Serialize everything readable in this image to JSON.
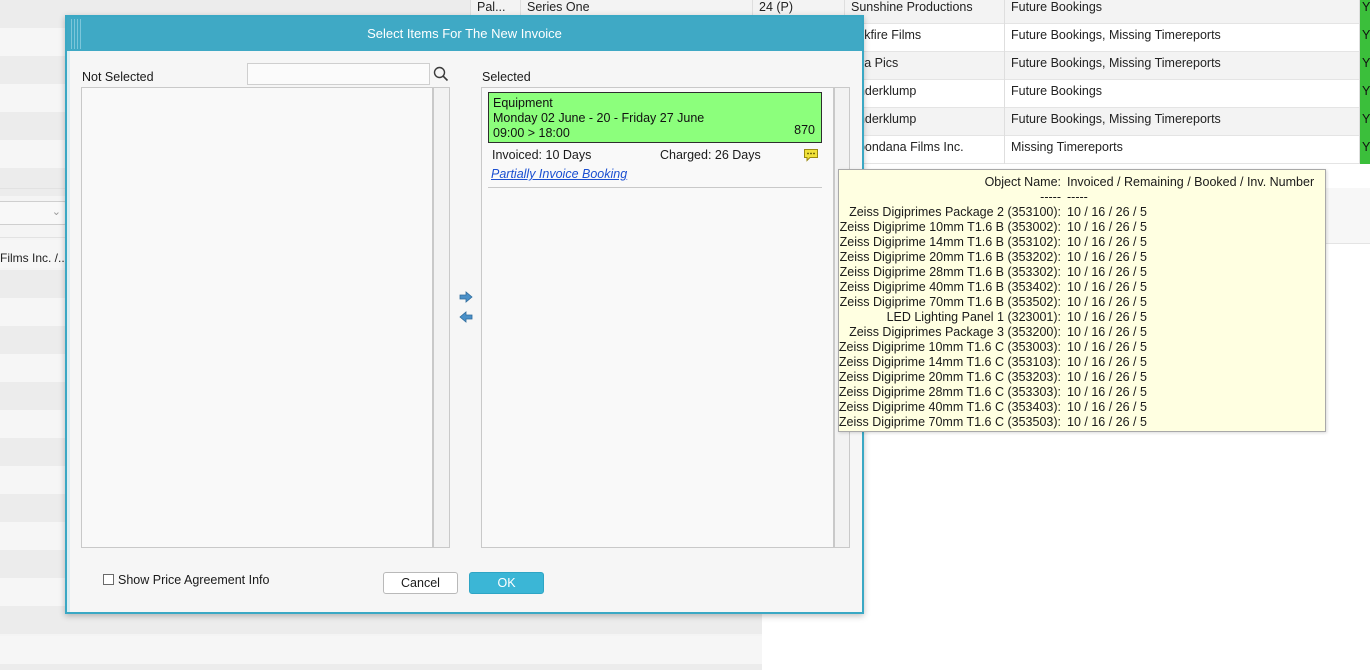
{
  "background": {
    "left_panel": {
      "clipped_text": "Films Inc. /.."
    },
    "table_rows": [
      {
        "col1": "Pal...",
        "col2": "Series One",
        "col3": "24 (P)",
        "company": "Sunshine Productions",
        "status": "Future Bookings",
        "flag": "Y"
      },
      {
        "col1": "",
        "col2": "",
        "col3": "",
        "company": "ackfire Films",
        "status": "Future Bookings, Missing Timereports",
        "flag": "Y"
      },
      {
        "col1": "",
        "col2": "",
        "col3": "",
        "company": "aya Pics",
        "status": "Future Bookings, Missing Timereports",
        "flag": "Y"
      },
      {
        "col1": "",
        "col2": "",
        "col3": "",
        "company": "underklump",
        "status": "Future Bookings",
        "flag": "Y"
      },
      {
        "col1": "",
        "col2": "",
        "col3": "",
        "company": "underklump",
        "status": "Future Bookings, Missing Timereports",
        "flag": "Y"
      },
      {
        "col1": "",
        "col2": "",
        "col3": "",
        "company": "apondana Films Inc.",
        "status": "Missing Timereports",
        "flag": "Y"
      }
    ],
    "colors": {
      "flag_green": "#3bbf3b"
    }
  },
  "dialog": {
    "title": "Select Items For The New Invoice",
    "not_selected_label": "Not Selected",
    "search": {
      "value": "",
      "placeholder": "",
      "icon": "search-icon"
    },
    "selected_label": "Selected",
    "booking": {
      "title": "Equipment",
      "dates": "Monday 02 June - 20 - Friday 27 June",
      "time": "09:00 > 18:00",
      "number": "870",
      "invoiced": "Invoiced: 10 Days",
      "charged": "Charged: 26 Days",
      "comment_icon": "comment-icon",
      "partial_link": "Partially Invoice Booking"
    },
    "move_right_icon": "arrow-right-icon",
    "move_left_icon": "arrow-left-icon",
    "show_price_agreement_label": "Show Price Agreement Info",
    "show_price_agreement_checked": false,
    "cancel_label": "Cancel",
    "ok_label": "OK",
    "colors": {
      "titlebar": "#3fa9c5",
      "booking_card": "#8cff7c",
      "ok_button": "#3bb6d6",
      "link": "#1b4fd1"
    }
  },
  "tooltip": {
    "header_name": "Object Name:",
    "header_value": "Invoiced / Remaining / Booked / Inv. Number",
    "separator_name": "-----",
    "separator_value": "-----",
    "items": [
      {
        "name": "Zeiss Digiprimes Package 2 (353100):",
        "value": "10 / 16 / 26 / 5"
      },
      {
        "name": "Zeiss Digiprime 10mm T1.6 B (353002):",
        "value": "10 / 16 / 26 / 5"
      },
      {
        "name": "Zeiss Digiprime 14mm T1.6 B (353102):",
        "value": "10 / 16 / 26 / 5"
      },
      {
        "name": "Zeiss Digiprime 20mm T1.6 B (353202):",
        "value": "10 / 16 / 26 / 5"
      },
      {
        "name": "Zeiss Digiprime 28mm T1.6 B (353302):",
        "value": "10 / 16 / 26 / 5"
      },
      {
        "name": "Zeiss Digiprime 40mm T1.6 B (353402):",
        "value": "10 / 16 / 26 / 5"
      },
      {
        "name": "Zeiss Digiprime 70mm T1.6 B (353502):",
        "value": "10 / 16 / 26 / 5"
      },
      {
        "name": "LED Lighting Panel 1 (323001):",
        "value": "10 / 16 / 26 / 5"
      },
      {
        "name": "Zeiss Digiprimes Package 3 (353200):",
        "value": "10 / 16 / 26 / 5"
      },
      {
        "name": "Zeiss Digiprime 10mm T1.6 C (353003):",
        "value": "10 / 16 / 26 / 5"
      },
      {
        "name": "Zeiss Digiprime 14mm T1.6 C (353103):",
        "value": "10 / 16 / 26 / 5"
      },
      {
        "name": "Zeiss Digiprime 20mm T1.6 C (353203):",
        "value": "10 / 16 / 26 / 5"
      },
      {
        "name": "Zeiss Digiprime 28mm T1.6 C (353303):",
        "value": "10 / 16 / 26 / 5"
      },
      {
        "name": "Zeiss Digiprime 40mm T1.6 C (353403):",
        "value": "10 / 16 / 26 / 5"
      },
      {
        "name": "Zeiss Digiprime 70mm T1.6 C (353503):",
        "value": "10 / 16 / 26 / 5"
      }
    ]
  }
}
